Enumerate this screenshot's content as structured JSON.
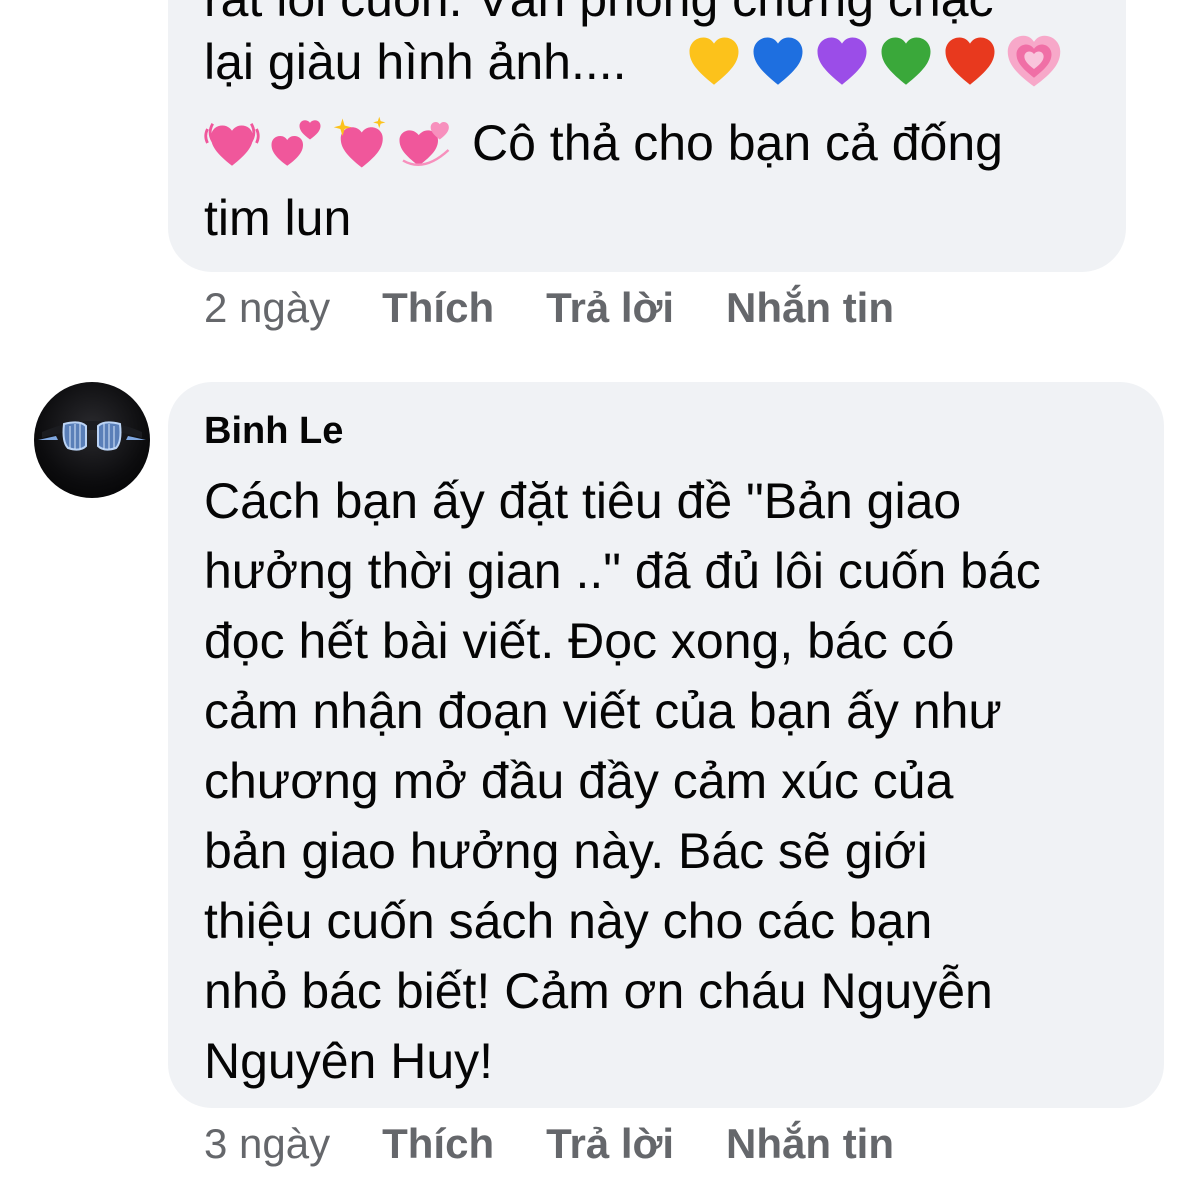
{
  "comment_1": {
    "lines": [
      "rất lôi cuốn. Văn phong chững chạc",
      "lại giàu hình ảnh....",
      "Cô thả cho bạn cả đống",
      "tim lun"
    ],
    "hearts_row_1": [
      "yellow-heart-icon",
      "blue-heart-icon",
      "purple-heart-icon",
      "green-heart-icon",
      "red-heart-icon",
      "growing-heart-icon"
    ],
    "hearts_row_2": [
      "beating-heart-icon",
      "two-hearts-icon",
      "sparkling-heart-icon",
      "revolving-hearts-icon"
    ],
    "time": "2 ngày",
    "like": "Thích",
    "reply": "Trả lời",
    "message": "Nhắn tin"
  },
  "comment_2": {
    "author": "Binh Le",
    "lines": [
      "Cách bạn ấy đặt tiêu đề \"Bản giao",
      "hưởng thời gian ..\" đã đủ lôi cuốn bác",
      "đọc hết bài viết. Đọc xong, bác có",
      "cảm nhận đoạn viết của bạn ấy như",
      "chương mở đầu đầy cảm xúc của",
      "bản giao hưởng này. Bác sẽ giới",
      "thiệu cuốn sách này cho các bạn",
      "nhỏ bác biết! Cảm ơn cháu Nguyễn",
      "Nguyên Huy!"
    ],
    "time": "3 ngày",
    "like": "Thích",
    "reply": "Trả lời",
    "message": "Nhắn tin"
  },
  "colors": {
    "bubble": "#f0f2f5",
    "text": "#050505",
    "meta": "#65676b"
  }
}
